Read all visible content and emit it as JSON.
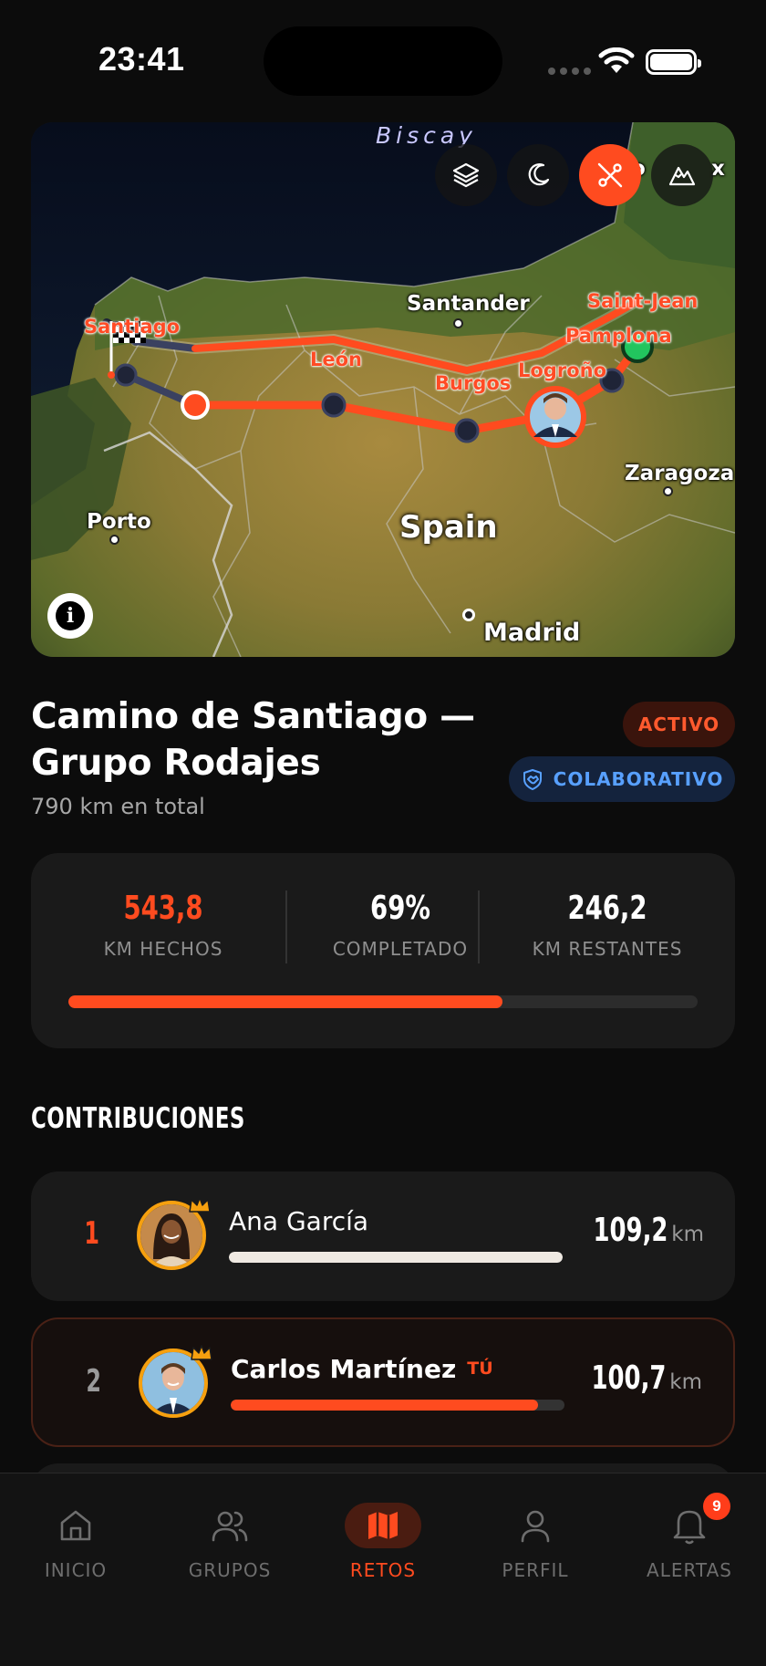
{
  "status_bar": {
    "time": "23:41"
  },
  "map": {
    "sea_label": "Biscay",
    "country_label": "Spain",
    "cities": {
      "santander": "Santander",
      "porto": "Porto",
      "zaragoza": "Zaragoza",
      "madrid": "Madrid",
      "bordeaux_fragment": "o",
      "edge_fragment": "x"
    },
    "route_stops": {
      "santiago": "Santiago",
      "leon": "León",
      "burgos": "Burgos",
      "logrono": "Logroño",
      "pamplona": "Pamplona",
      "saint_jean": "Saint-Jean"
    },
    "controls": [
      "layers-icon",
      "moon-icon",
      "route-icon",
      "terrain-icon"
    ],
    "active_control": "route-icon",
    "route_color": "#ff4b1f"
  },
  "challenge": {
    "title_line1": "Camino de Santiago —",
    "title_line2": "Grupo Rodajes",
    "subtitle": "790 km en total",
    "status_badge": "ACTIVO",
    "type_badge": "COLABORATIVO"
  },
  "stats": {
    "done_value": "543,8",
    "done_label": "KM HECHOS",
    "percent_value": "69%",
    "percent_label": "COMPLETADO",
    "remaining_value": "246,2",
    "remaining_label": "KM RESTANTES",
    "progress_fraction": 0.69
  },
  "contributions": {
    "title": "CONTRIBUCIONES",
    "rows": [
      {
        "rank": "1",
        "name": "Ana García",
        "km": "109,2",
        "unit": "km",
        "bar_fraction": 1.0,
        "bar_color": "#efe9e2",
        "is_me": false
      },
      {
        "rank": "2",
        "name": "Carlos Martínez",
        "you_tag": "TÚ",
        "km": "100,7",
        "unit": "km",
        "bar_fraction": 0.92,
        "bar_color": "#ff4b1f",
        "is_me": true
      }
    ]
  },
  "nav": {
    "items": [
      {
        "label": "INICIO",
        "icon": "home-icon"
      },
      {
        "label": "GRUPOS",
        "icon": "users-icon"
      },
      {
        "label": "RETOS",
        "icon": "map-icon"
      },
      {
        "label": "PERFIL",
        "icon": "user-icon"
      },
      {
        "label": "ALERTAS",
        "icon": "bell-icon"
      }
    ],
    "active": "RETOS",
    "alerts_badge": "9"
  }
}
